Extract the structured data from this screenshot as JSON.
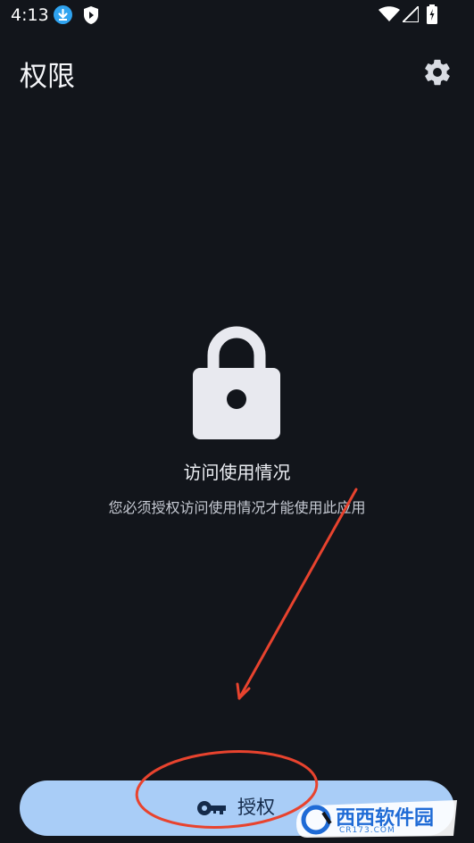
{
  "status_bar": {
    "time": "4:13",
    "icons": [
      "download-icon",
      "shield-icon",
      "wifi-icon",
      "signal-icon",
      "battery-icon"
    ]
  },
  "header": {
    "title": "权限",
    "settings_icon": "gear-icon"
  },
  "permission": {
    "icon": "lock-icon",
    "title": "访问使用情况",
    "description": "您必须授权访问使用情况才能使用此应用"
  },
  "grant_button": {
    "icon": "key-icon",
    "label": "授权"
  },
  "annotation": {
    "color": "#e8432e",
    "shapes": [
      "arrow",
      "ellipse"
    ]
  },
  "watermark": {
    "text": "西西软件园",
    "sub": "CR173.COM"
  },
  "colors": {
    "background": "#12151b",
    "button": "#a9cdf7",
    "button_text": "#142a4a"
  }
}
